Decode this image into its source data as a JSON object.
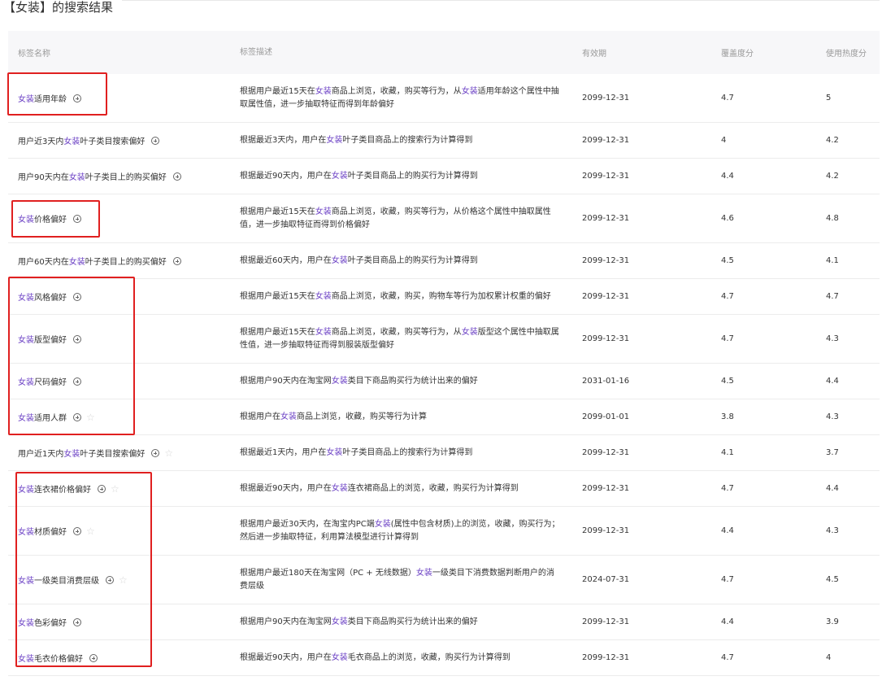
{
  "page": {
    "title": "【女装】的搜索结果"
  },
  "columns": {
    "name": "标签名称",
    "desc": "标签描述",
    "date": "有效期",
    "coverage": "覆盖度分",
    "heat": "使用热度分"
  },
  "rows": [
    {
      "name": [
        [
          "女装",
          "hl"
        ],
        [
          "适用年龄",
          ""
        ]
      ],
      "desc": [
        [
          "根据用户最近15天在",
          ""
        ],
        [
          "女装",
          "hl"
        ],
        [
          "商品上浏览，收藏，购买等行为，从",
          ""
        ],
        [
          "女装",
          "hl"
        ],
        [
          "适用年龄这个属性中抽取属性值，进一步抽取特征而得到年龄偏好",
          ""
        ]
      ],
      "date": "2099-12-31",
      "coverage": "4.7",
      "heat": "5",
      "star": false,
      "h": 60
    },
    {
      "name": [
        [
          "用户近3天内",
          ""
        ],
        [
          "女装",
          "hl"
        ],
        [
          "叶子类目搜索偏好",
          ""
        ]
      ],
      "desc": [
        [
          "根据最近3天内，用户在",
          ""
        ],
        [
          "女装",
          "hl"
        ],
        [
          "叶子类目商品上的搜索行为计算得到",
          ""
        ]
      ],
      "date": "2099-12-31",
      "coverage": "4",
      "heat": "4.2",
      "star": false,
      "h": 44
    },
    {
      "name": [
        [
          "用户90天内在",
          ""
        ],
        [
          "女装",
          "hl"
        ],
        [
          "叶子类目上的购买偏好",
          ""
        ]
      ],
      "desc": [
        [
          "根据最近90天内，用户在",
          ""
        ],
        [
          "女装",
          "hl"
        ],
        [
          "叶子类目商品上的购买行为计算得到",
          ""
        ]
      ],
      "date": "2099-12-31",
      "coverage": "4.4",
      "heat": "4.2",
      "star": false,
      "h": 44
    },
    {
      "name": [
        [
          "女装",
          "hl"
        ],
        [
          "价格偏好",
          ""
        ]
      ],
      "desc": [
        [
          "根据用户最近15天在",
          ""
        ],
        [
          "女装",
          "hl"
        ],
        [
          "商品上浏览，收藏，购买等行为，从价格这个属性中抽取属性值，进一步抽取特征而得到价格偏好",
          ""
        ]
      ],
      "date": "2099-12-31",
      "coverage": "4.6",
      "heat": "4.8",
      "star": false,
      "h": 60
    },
    {
      "name": [
        [
          "用户60天内在",
          ""
        ],
        [
          "女装",
          "hl"
        ],
        [
          "叶子类目上的购买偏好",
          ""
        ]
      ],
      "desc": [
        [
          "根据最近60天内，用户在",
          ""
        ],
        [
          "女装",
          "hl"
        ],
        [
          "叶子类目商品上的购买行为计算得到",
          ""
        ]
      ],
      "date": "2099-12-31",
      "coverage": "4.5",
      "heat": "4.1",
      "star": false,
      "h": 44
    },
    {
      "name": [
        [
          "女装",
          "hl"
        ],
        [
          "风格偏好",
          ""
        ]
      ],
      "desc": [
        [
          "根据用户最近15天在",
          ""
        ],
        [
          "女装",
          "hl"
        ],
        [
          "商品上浏览，收藏，购买，购物车等行为加权累计权重的偏好",
          ""
        ]
      ],
      "date": "2099-12-31",
      "coverage": "4.7",
      "heat": "4.7",
      "star": false,
      "h": 44
    },
    {
      "name": [
        [
          "女装",
          "hl"
        ],
        [
          "版型偏好",
          ""
        ]
      ],
      "desc": [
        [
          "根据用户最近15天在",
          ""
        ],
        [
          "女装",
          "hl"
        ],
        [
          "商品上浏览，收藏，购买等行为，从",
          ""
        ],
        [
          "女装",
          "hl"
        ],
        [
          "版型这个属性中抽取属性值，进一步抽取特征而得到服装版型偏好",
          ""
        ]
      ],
      "date": "2099-12-31",
      "coverage": "4.7",
      "heat": "4.3",
      "star": false,
      "h": 60
    },
    {
      "name": [
        [
          "女装",
          "hl"
        ],
        [
          "尺码偏好",
          ""
        ]
      ],
      "desc": [
        [
          "根据用户90天内在淘宝网",
          ""
        ],
        [
          "女装",
          "hl"
        ],
        [
          "类目下商品购买行为统计出来的偏好",
          ""
        ]
      ],
      "date": "2031-01-16",
      "coverage": "4.5",
      "heat": "4.4",
      "star": false,
      "h": 44
    },
    {
      "name": [
        [
          "女装",
          "hl"
        ],
        [
          "适用人群",
          ""
        ]
      ],
      "desc": [
        [
          "根据用户在",
          ""
        ],
        [
          "女装",
          "hl"
        ],
        [
          "商品上浏览，收藏，购买等行为计算",
          ""
        ]
      ],
      "date": "2099-01-01",
      "coverage": "3.8",
      "heat": "4.3",
      "star": true,
      "h": 44
    },
    {
      "name": [
        [
          "用户近1天内",
          ""
        ],
        [
          "女装",
          "hl"
        ],
        [
          "叶子类目搜索偏好",
          ""
        ]
      ],
      "desc": [
        [
          "根据最近1天内，用户在",
          ""
        ],
        [
          "女装",
          "hl"
        ],
        [
          "叶子类目商品上的搜索行为计算得到",
          ""
        ]
      ],
      "date": "2099-12-31",
      "coverage": "4.1",
      "heat": "3.7",
      "star": true,
      "h": 44
    },
    {
      "name": [
        [
          "女装",
          "hl"
        ],
        [
          "连衣裙价格偏好",
          ""
        ]
      ],
      "desc": [
        [
          "根据最近90天内，用户在",
          ""
        ],
        [
          "女装",
          "hl"
        ],
        [
          "连衣裙商品上的浏览，收藏，购买行为计算得到",
          ""
        ]
      ],
      "date": "2099-12-31",
      "coverage": "4.7",
      "heat": "4.4",
      "star": true,
      "h": 44
    },
    {
      "name": [
        [
          "女装",
          "hl"
        ],
        [
          "材质偏好",
          ""
        ]
      ],
      "desc": [
        [
          "根据用户最近30天内，在淘宝内PC端",
          ""
        ],
        [
          "女装",
          "hl"
        ],
        [
          "(属性中包含材质)上的浏览，收藏，购买行为；然后进一步抽取特征，利用算法模型进行计算得到",
          ""
        ]
      ],
      "date": "2099-12-31",
      "coverage": "4.4",
      "heat": "4.3",
      "star": true,
      "h": 60
    },
    {
      "name": [
        [
          "女装",
          "hl"
        ],
        [
          "一级类目消费层级",
          ""
        ]
      ],
      "desc": [
        [
          "根据用户最近180天在淘宝网（PC + 无线数据）",
          ""
        ],
        [
          "女装",
          "hl"
        ],
        [
          "一级类目下消费数据判断用户的消费层级",
          ""
        ]
      ],
      "date": "2024-07-31",
      "coverage": "4.7",
      "heat": "4.5",
      "star": true,
      "h": 60
    },
    {
      "name": [
        [
          "女装",
          "hl"
        ],
        [
          "色彩偏好",
          ""
        ]
      ],
      "desc": [
        [
          "根据用户90天内在淘宝网",
          ""
        ],
        [
          "女装",
          "hl"
        ],
        [
          "类目下商品购买行为统计出来的偏好",
          ""
        ]
      ],
      "date": "2099-12-31",
      "coverage": "4.4",
      "heat": "3.9",
      "star": false,
      "h": 44
    },
    {
      "name": [
        [
          "女装",
          "hl"
        ],
        [
          "毛衣价格偏好",
          ""
        ]
      ],
      "desc": [
        [
          "根据最近90天内，用户在",
          ""
        ],
        [
          "女装",
          "hl"
        ],
        [
          "毛衣商品上的浏览，收藏，购买行为计算得到",
          ""
        ]
      ],
      "date": "2099-12-31",
      "coverage": "4.7",
      "heat": "4",
      "star": false,
      "h": 44
    }
  ],
  "colors": {
    "highlight": "#6a3fc4",
    "box": "#e02020",
    "header_bg": "#f7f7f9"
  },
  "icons": {
    "add": "plus-circle-icon",
    "star": "star-outline-icon"
  }
}
